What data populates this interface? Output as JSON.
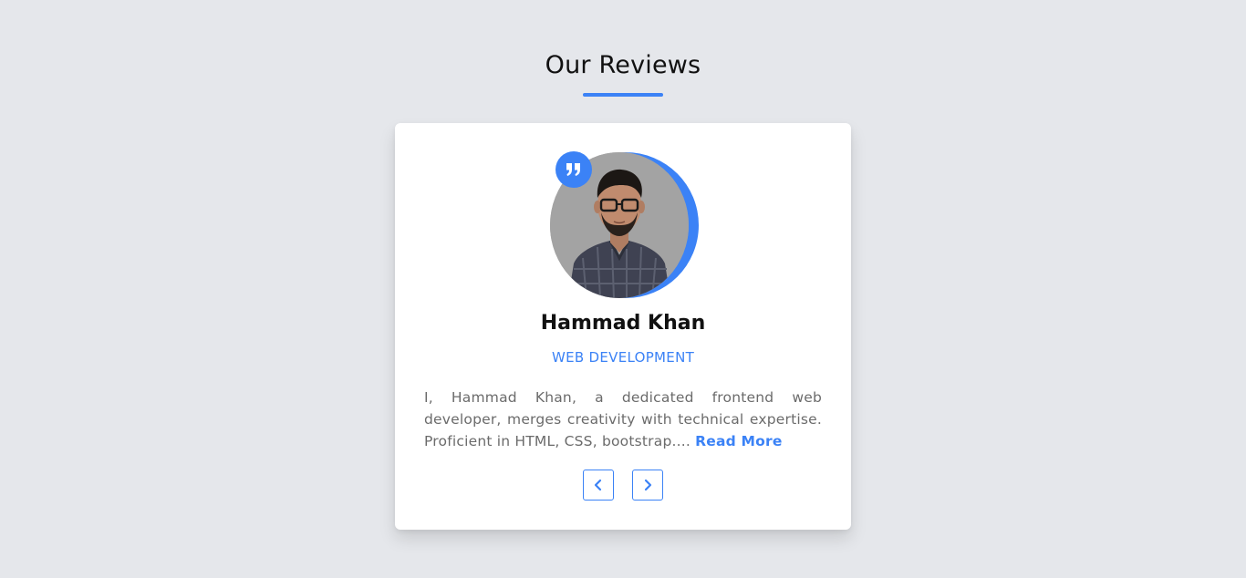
{
  "section": {
    "title": "Our Reviews"
  },
  "review": {
    "name": "Hammad Khan",
    "role": "WEB DEVELOPMENT",
    "text": "I, Hammad Khan, a dedicated frontend web developer, merges creativity with technical expertise. Proficient in HTML, CSS, bootstrap....",
    "read_more_label": "Read More",
    "quote_icon": "quote-icon",
    "avatar_icon": "avatar-photo"
  },
  "navigation": {
    "prev_icon": "chevron-left-icon",
    "next_icon": "chevron-right-icon"
  },
  "colors": {
    "accent": "#3b82f6",
    "background": "#e5e7eb",
    "card": "#ffffff",
    "heading": "#111111",
    "body_text": "#6b6b6b"
  }
}
